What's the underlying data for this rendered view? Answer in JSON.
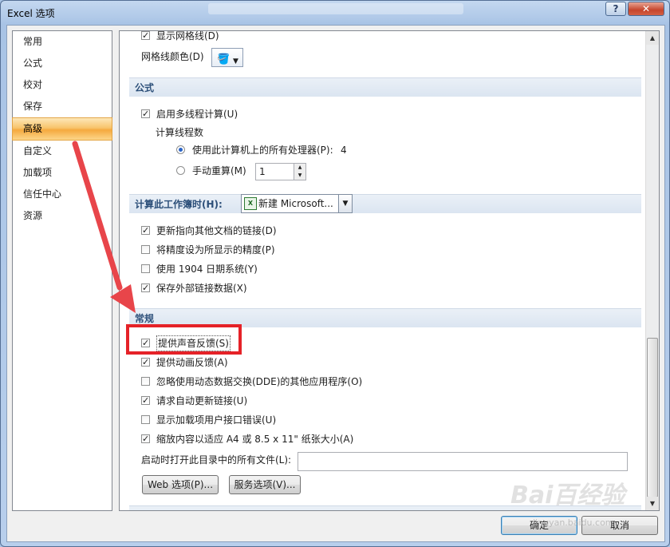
{
  "window": {
    "title": "Excel 选项",
    "help_label": "?",
    "close_label": "✕"
  },
  "nav": {
    "items": [
      {
        "label": "常用"
      },
      {
        "label": "公式"
      },
      {
        "label": "校对"
      },
      {
        "label": "保存"
      },
      {
        "label": "高级",
        "selected": true
      },
      {
        "label": "自定义"
      },
      {
        "label": "加载项"
      },
      {
        "label": "信任中心"
      },
      {
        "label": "资源"
      }
    ]
  },
  "display": {
    "show_gridlines": {
      "label": "显示网格线(D)",
      "checked": true
    },
    "gridline_color_label": "网格线颜色(D)"
  },
  "formulas": {
    "header": "公式",
    "multithread": {
      "label": "启用多线程计算(U)",
      "checked": true
    },
    "threads_label": "计算线程数",
    "use_all": {
      "label": "使用此计算机上的所有处理器(P):",
      "value": "4",
      "selected": true
    },
    "manual": {
      "label": "手动重算(M)",
      "value": "1",
      "selected": false
    }
  },
  "calc_workbook": {
    "header": "计算此工作簿时(H):",
    "selected_workbook": "新建 Microsoft...",
    "options": [
      {
        "label": "更新指向其他文档的链接(D)",
        "checked": true
      },
      {
        "label": "将精度设为所显示的精度(P)",
        "checked": false
      },
      {
        "label": "使用 1904 日期系统(Y)",
        "checked": false
      },
      {
        "label": "保存外部链接数据(X)",
        "checked": true
      }
    ]
  },
  "general": {
    "header": "常规",
    "options": [
      {
        "label": "提供声音反馈(S)",
        "checked": true
      },
      {
        "label": "提供动画反馈(A)",
        "checked": true
      },
      {
        "label": "忽略使用动态数据交换(DDE)的其他应用程序(O)",
        "checked": false
      },
      {
        "label": "请求自动更新链接(U)",
        "checked": true
      },
      {
        "label": "显示加载项用户接口错误(U)",
        "checked": false
      },
      {
        "label": "缩放内容以适应 A4 或 8.5 x 11\" 纸张大小(A)",
        "checked": true
      }
    ],
    "startup_label": "启动时打开此目录中的所有文件(L):",
    "startup_value": "",
    "web_options_label": "Web 选项(P)...",
    "service_options_label": "服务选项(V)..."
  },
  "footer": {
    "ok_label": "确定",
    "cancel_label": "取消"
  },
  "watermark": {
    "brand": "Bai百经验",
    "url": "jingyan.baidu.com"
  }
}
